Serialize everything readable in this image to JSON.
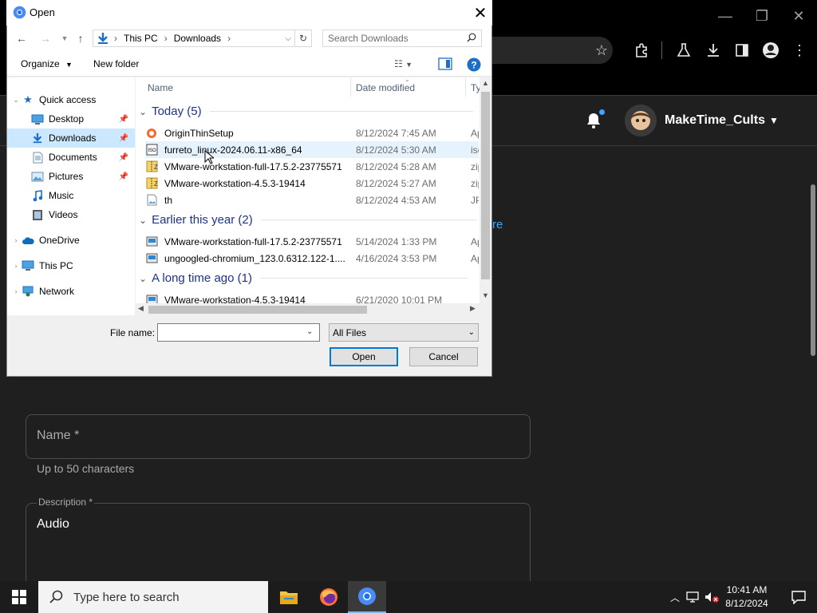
{
  "chrome": {
    "window_controls": {
      "minimize": "—",
      "restore": "❐",
      "close": "✕"
    },
    "toolbar_icons": [
      "star-icon",
      "extensions-icon",
      "labs-icon",
      "download-icon",
      "sidepanel-icon",
      "profile-icon",
      "menu-icon"
    ]
  },
  "page": {
    "channel_name": "MakeTime_Cults",
    "learn_more_fragment": "re",
    "name_field": {
      "label": "Name *",
      "value": "",
      "help": "Up to 50 characters"
    },
    "description_field": {
      "label": "Description *",
      "value": "Audio"
    }
  },
  "dialog": {
    "title": "Open",
    "address": {
      "root": "This PC",
      "folder": "Downloads"
    },
    "search_placeholder": "Search Downloads",
    "commands": {
      "organize": "Organize",
      "new_folder": "New folder"
    },
    "nav": {
      "quick_access": "Quick access",
      "items": [
        {
          "label": "Desktop",
          "icon": "desktop-icon",
          "pinned": true
        },
        {
          "label": "Downloads",
          "icon": "downloads-icon",
          "pinned": true,
          "selected": true
        },
        {
          "label": "Documents",
          "icon": "documents-icon",
          "pinned": true
        },
        {
          "label": "Pictures",
          "icon": "pictures-icon",
          "pinned": true
        },
        {
          "label": "Music",
          "icon": "music-icon"
        },
        {
          "label": "Videos",
          "icon": "videos-icon"
        }
      ],
      "onedrive": "OneDrive",
      "this_pc": "This PC",
      "network": "Network"
    },
    "columns": {
      "name": "Name",
      "date": "Date modified",
      "type": "Ty"
    },
    "groups": [
      {
        "label": "Today (5)",
        "files": [
          {
            "name": "OriginThinSetup",
            "date": "8/12/2024 7:45 AM",
            "type": "Ap",
            "icon": "origin-icon"
          },
          {
            "name": "furreto_linux-2024.06.11-x86_64",
            "date": "8/12/2024 5:30 AM",
            "type": "isc",
            "icon": "iso-icon"
          },
          {
            "name": "VMware-workstation-full-17.5.2-23775571",
            "date": "8/12/2024 5:28 AM",
            "type": "zip",
            "icon": "zip-icon"
          },
          {
            "name": "VMware-workstation-4.5.3-19414",
            "date": "8/12/2024 5:27 AM",
            "type": "zip",
            "icon": "zip-icon"
          },
          {
            "name": "th",
            "date": "8/12/2024 4:53 AM",
            "type": "JP",
            "icon": "image-icon"
          }
        ]
      },
      {
        "label": "Earlier this year (2)",
        "files": [
          {
            "name": "VMware-workstation-full-17.5.2-23775571",
            "date": "5/14/2024 1:33 PM",
            "type": "Ap",
            "icon": "installer-icon"
          },
          {
            "name": "ungoogled-chromium_123.0.6312.122-1....",
            "date": "4/16/2024 3:53 PM",
            "type": "Ap",
            "icon": "installer-icon"
          }
        ]
      },
      {
        "label": "A long time ago (1)",
        "files": [
          {
            "name": "VMware-workstation-4.5.3-19414",
            "date": "6/21/2020 10:01 PM",
            "type": "",
            "icon": "installer-icon"
          }
        ]
      }
    ],
    "file_name_label": "File name:",
    "file_name_value": "",
    "file_type": "All Files",
    "open_label": "Open",
    "cancel_label": "Cancel"
  },
  "taskbar": {
    "search_placeholder": "Type here to search",
    "time": "10:41 AM",
    "date": "8/12/2024"
  },
  "colors": {
    "accent": "#0078d7",
    "yt_blue": "#3ea6ff",
    "selected": "#cce8ff"
  }
}
